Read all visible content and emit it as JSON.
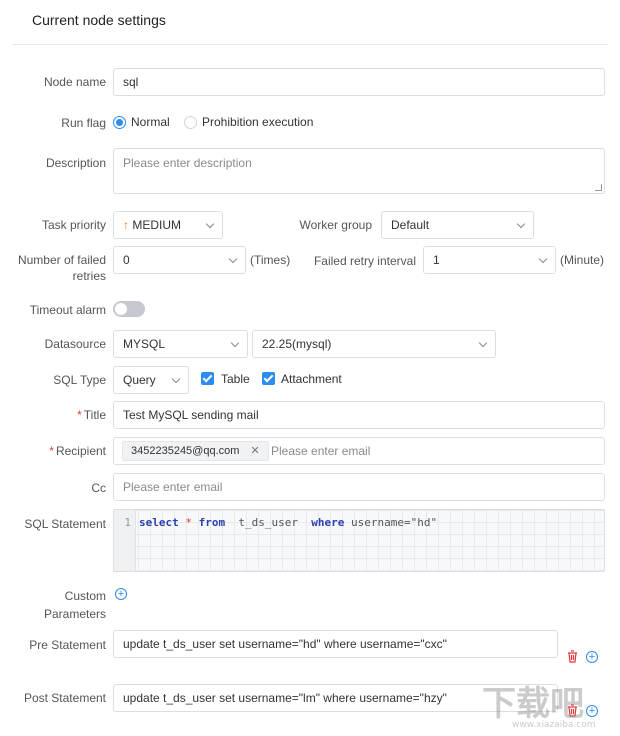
{
  "header": {
    "title": "Current node settings"
  },
  "fields": {
    "node_name": {
      "label": "Node name",
      "value": "sql"
    },
    "run_flag": {
      "label": "Run flag",
      "options": [
        "Normal",
        "Prohibition execution"
      ],
      "selected": "Normal"
    },
    "description": {
      "label": "Description",
      "placeholder": "Please enter description"
    },
    "task_priority": {
      "label": "Task priority",
      "value": "MEDIUM"
    },
    "worker_group": {
      "label": "Worker group",
      "value": "Default"
    },
    "failed_retries": {
      "label_line1": "Number of failed",
      "label_line2": "retries",
      "value": "0",
      "unit": "(Times)"
    },
    "retry_interval": {
      "label": "Failed retry interval",
      "value": "1",
      "unit": "(Minute)"
    },
    "timeout_alarm": {
      "label": "Timeout alarm",
      "enabled": false
    },
    "datasource": {
      "label": "Datasource",
      "type": "MYSQL",
      "instance": "22.25(mysql)"
    },
    "sql_type": {
      "label": "SQL Type",
      "value": "Query",
      "options": [
        "Table",
        "Attachment"
      ]
    },
    "title": {
      "label": "Title",
      "value": "Test MySQL sending mail"
    },
    "recipient": {
      "label": "Recipient",
      "tag": "3452235245@qq.com",
      "placeholder": "Please enter email"
    },
    "cc": {
      "label": "Cc",
      "placeholder": "Please enter email"
    },
    "sql_statement": {
      "label": "SQL Statement",
      "line_number": "1",
      "kw_select": "select",
      "star": "*",
      "kw_from": "from",
      "table": "t_ds_user",
      "kw_where": "where",
      "condition": "username=\"hd\""
    },
    "custom_parameters": {
      "label_line1": "Custom",
      "label_line2": "Parameters"
    },
    "pre_statement": {
      "label": "Pre Statement",
      "value": "update t_ds_user set username=\"hd\"  where username=\"cxc\""
    },
    "post_statement": {
      "label": "Post Statement",
      "value": "update t_ds_user set username=\"lm\"  where username=\"hzy\""
    }
  },
  "watermark": {
    "main": "下载吧",
    "url": "www.xiazaiba.com"
  },
  "colors": {
    "accent": "#2d8cf0",
    "priority_arrow": "#f07a1a",
    "delete_icon": "#e4393c",
    "required_star": "#e4393c"
  }
}
